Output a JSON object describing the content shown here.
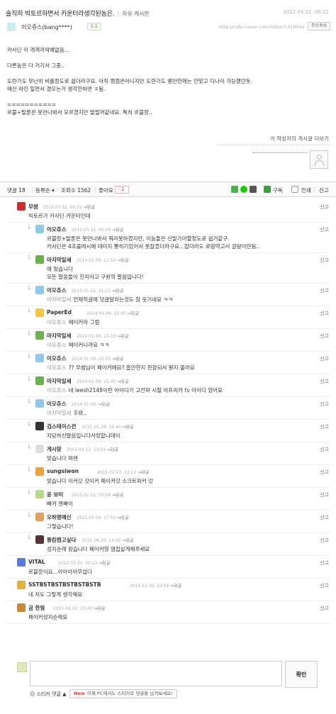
{
  "post": {
    "title": "솔직히 빅토르하면서 카운터라생각된놈은.",
    "board": "자유 게시판",
    "date": "2012.03.31. 00:21",
    "author": "이오쥬스(bang****)",
    "badge": "1:1",
    "url": "http://cafe.naver.com/lolkor/1318042",
    "copy_label": "주소복사",
    "body": [
      "카사딘 이 개객끼딱예없음...",
      "",
      "다른놈은 다 거기서 그중..",
      "",
      "도란가도 무난히 바를정도로 쉽더라구요. 아직 랭겜은아니지만 도란가도 웬만한애는 안맞고 디나이 가능했던듯.",
      "매신 라인 밀면서 경오는거 생각안하면 ㅈ됨.",
      "",
      "===========",
      "르블+탈론은 못만나봐서 모르겠지만 발릴꺼같네요. 특히 르블랑.."
    ],
    "more_link": "이 작성자의 게시글 더보기"
  },
  "comment_bar": {
    "count_label": "댓글 18",
    "order_label": "등록순",
    "views_label": "조회수 1562",
    "like_label": "좋아요",
    "like_count": "♡1",
    "subscribe": "구독",
    "print": "인쇄",
    "report": "신고"
  },
  "comments": [
    {
      "reply": false,
      "name": "무쌈",
      "date": "2012.03.31. 00:22",
      "mention": "",
      "text": "빅토르가 카사딘 카운터인데"
    },
    {
      "reply": true,
      "name": "이오쥬스",
      "date": "2012.03.31. 00:24",
      "mention": "",
      "text": "르블랑+탈론은 못만나봐서 뭐라못하겠지만, 이놈들은 신발가야할정도로 쉽거같구.",
      "text2": "카사딘은 4조콜레시에 데미지 뽕히기있어서 못잡겠더라구요.. 잡더라도 로밍먹고서 갈땅이안됨.."
    },
    {
      "reply": true,
      "name": "마지막일세",
      "date": "2014.01.09. 11:55",
      "mention": "",
      "text": "에 맞습니다",
      "text2": "모든 말씀들이 진리이고 구원의 말씀입니다!"
    },
    {
      "reply": true,
      "name": "이오쥬스",
      "date": "2015.01.21. 21:22",
      "mention": "마지막일세",
      "text": "언제적글에 덧글달리는것도 참 웃기네요 ㅋㅋ"
    },
    {
      "reply": true,
      "name": "PaperEd",
      "date": "2014.01.09. 15:05",
      "mention": "이오쥬스",
      "text": "페이커라 그럼"
    },
    {
      "reply": true,
      "name": "마지막일세",
      "date": "2014.01.09. 15:10",
      "mention": "이오쥬스",
      "text": "페이커니까요 ㅋㅋ"
    },
    {
      "reply": true,
      "name": "이오쥬스",
      "date": "2014.01.09. 15:33",
      "mention": "이오쥬스",
      "text": "?? 무쌈님이 페이커에요? 흠안한지 한참되서 뭔지 몰라요"
    },
    {
      "reply": true,
      "name": "마지막일세",
      "date": "2014.01.09. 15:45",
      "mention": "이오쥬스",
      "text": "네 leesh2148이란 아이디가 고전파 시절 아프리카 tv 아이디 었어요"
    },
    {
      "reply": true,
      "name": "이오쥬스",
      "date": "2014.01.09.",
      "mention": "마지막일세",
      "text": "우와.."
    },
    {
      "reply": true,
      "name": "검스테이스전",
      "date": "2015.01.28. 19:44",
      "mention": "",
      "text": "지당하신말씀입니다사랑합니데이"
    },
    {
      "reply": true,
      "name": "게시망",
      "date": "2015.02.13. 23:24",
      "mention": "",
      "text": "맞습니다 퍼렌"
    },
    {
      "reply": true,
      "name": "sungsiwon",
      "date": "2015.02.17. 23:22",
      "mention": "",
      "text": "맞습니다 이커갓 갓이커 페이커갓 스크트파커 갓"
    },
    {
      "reply": true,
      "name": "윤 보미",
      "date": "2015.02.21. 10:50",
      "mention": "",
      "text": "빠커 젠빠이"
    },
    {
      "reply": true,
      "name": "오하영예신",
      "date": "2015.05.04. 17:50",
      "mention": "",
      "text": "그렇습니다!"
    },
    {
      "reply": true,
      "name": "롱캄켬고싶다",
      "date": "2015.08.20. 14:02",
      "mention": "",
      "text": "성지순례 왔습니다 페이커형 염집살게해주세요"
    },
    {
      "reply": false,
      "name": "VITAL",
      "date": "2012.03.31. 00:22",
      "mention": "",
      "text": "르블랑이요...아아아아무섭다"
    },
    {
      "reply": false,
      "name": "SSTBSTBSTBSTBSTBSTB",
      "date": "2014.12.30. 22:04",
      "mention": "",
      "text": "네 저도 그렇게 생각해요"
    },
    {
      "reply": false,
      "name": "곰 한형",
      "date": "2015.02.22. 15:40",
      "mention": "",
      "text": "페이커성지순례요"
    }
  ],
  "reply_label": "↪답글",
  "report_label": "신고",
  "write": {
    "confirm": "확인",
    "sticker_label": "☺ 스티커 댓글 ▲",
    "new_tag": "New",
    "banner": "이제 PC에서도 스티커로 댓글을 남겨보세요!"
  },
  "colors": {
    "reply_arrow": "#6ab4e6",
    "accent_red": "#cc3333",
    "subscribe_green": "#3aa03a"
  }
}
